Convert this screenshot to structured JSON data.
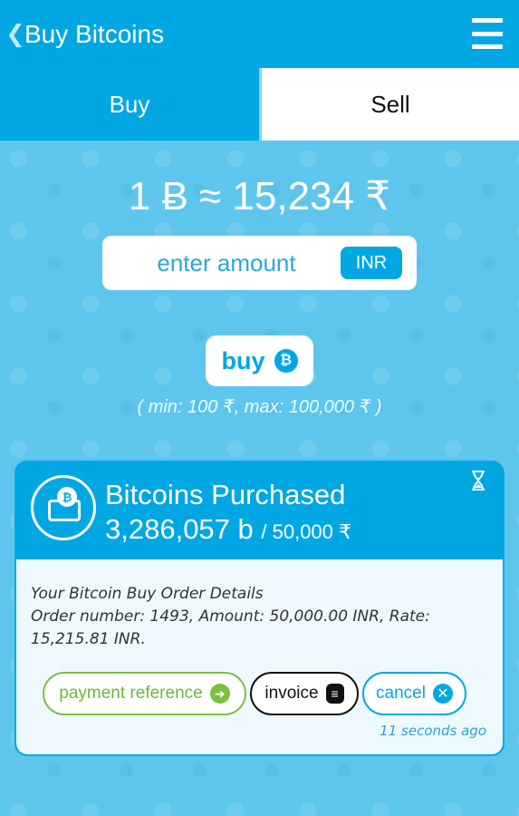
{
  "appbar": {
    "title": "Buy Bitcoins",
    "back_icon": "chevron-left-icon",
    "menu_icon": "hamburger-menu-icon"
  },
  "tabs": [
    {
      "label": "Buy",
      "active": true
    },
    {
      "label": "Sell",
      "active": false
    }
  ],
  "rate": {
    "text": "1 Ƀ ≈ 15,234 ₹"
  },
  "amount": {
    "placeholder": "enter amount",
    "value": "",
    "currency": "INR"
  },
  "buy": {
    "label": "buy",
    "icon": "bitcoin-icon",
    "limits": "( min: 100 ₹, max: 100,000 ₹ )"
  },
  "card": {
    "title": "Bitcoins Purchased",
    "bits": "3,286,057 b",
    "inr": "/ 50,000 ₹",
    "icon": "wallet-icon",
    "status_icon": "hourglass-icon",
    "details_line1": "Your Bitcoin Buy Order Details",
    "details_line2": "Order number: 1493, Amount: 50,000.00 INR, Rate: 15,215.81 INR.",
    "actions": {
      "payment_reference": "payment reference",
      "invoice": "invoice",
      "cancel": "cancel"
    },
    "timestamp": "11 seconds ago"
  },
  "colors": {
    "primary": "#00a7e3",
    "background": "#5ec6ec",
    "green": "#7ac142"
  }
}
